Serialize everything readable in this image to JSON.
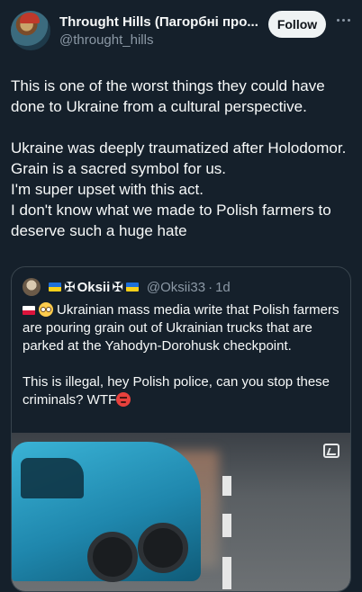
{
  "post": {
    "display_name": "Throught Hills (Пагорбні про...",
    "handle": "@throught_hills",
    "follow_label": "Follow",
    "text": [
      "This is one of the worst things they could have done to Ukraine from a cultural perspective.",
      "Ukraine was deeply traumatized after Holodomor. Grain is a sacred symbol for us.\nI'm super upset with this act.\nI don't know what we made to Polish farmers to deserve such a huge hate"
    ]
  },
  "quote": {
    "name": "Oksii",
    "name_decor": "✠",
    "handle": "@Oksii33",
    "separator": "·",
    "time": "1d",
    "text_1": "Ukrainian mass media write that Polish farmers are pouring grain out of Ukrainian trucks that are parked at the Yahodyn-Dorohusk checkpoint.",
    "text_2": "This is illegal, hey Polish police, can you stop these criminals? WTF"
  },
  "icons": {
    "more": "more-icon",
    "flag_pl": "flag-poland-icon",
    "flag_ua": "flag-ukraine-icon",
    "flushed": "flushed-face-emoji",
    "angry": "angry-face-emoji",
    "video": "video-badge-icon"
  },
  "colors": {
    "background": "#15202b",
    "text": "#f7f9f9",
    "muted": "#8b98a5",
    "border": "#38444d",
    "follow_bg": "#eff3f4"
  }
}
